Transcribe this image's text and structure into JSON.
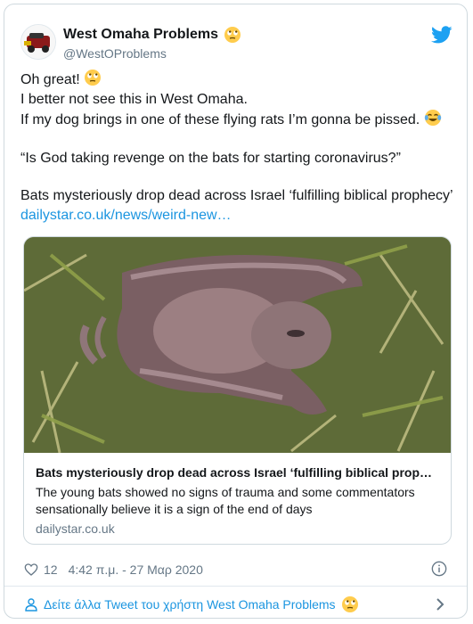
{
  "user": {
    "display_name": "West Omaha Problems",
    "handle": "@WestOProblems",
    "emoji": "eye-roll-emoji"
  },
  "tweet": {
    "line1": "Oh great!",
    "line2": "I better not see this in West Omaha.",
    "line3": "If my dog brings in one of these flying rats I’m gonna be pissed.",
    "quote": "“Is God taking revenge on the bats for starting coronavirus?”",
    "headline": "Bats mysteriously drop dead across Israel ‘fulfilling biblical prophecy’",
    "link": "dailystar.co.uk/news/weird-new…"
  },
  "card": {
    "title": "Bats mysteriously drop dead across Israel ‘fulfilling biblical proph…",
    "description": "The young bats showed no signs of trauma and some commentators sensationally believe it is a sign of the end of days",
    "domain": "dailystar.co.uk"
  },
  "footer": {
    "likes": "12",
    "timestamp": "4:42 π.μ. - 27 Μαρ 2020"
  },
  "more_tweets": {
    "label": "Δείτε άλλα Tweet του χρήστη West Omaha Problems"
  },
  "colors": {
    "accent": "#1b95e0",
    "secondary_text": "#657786"
  }
}
